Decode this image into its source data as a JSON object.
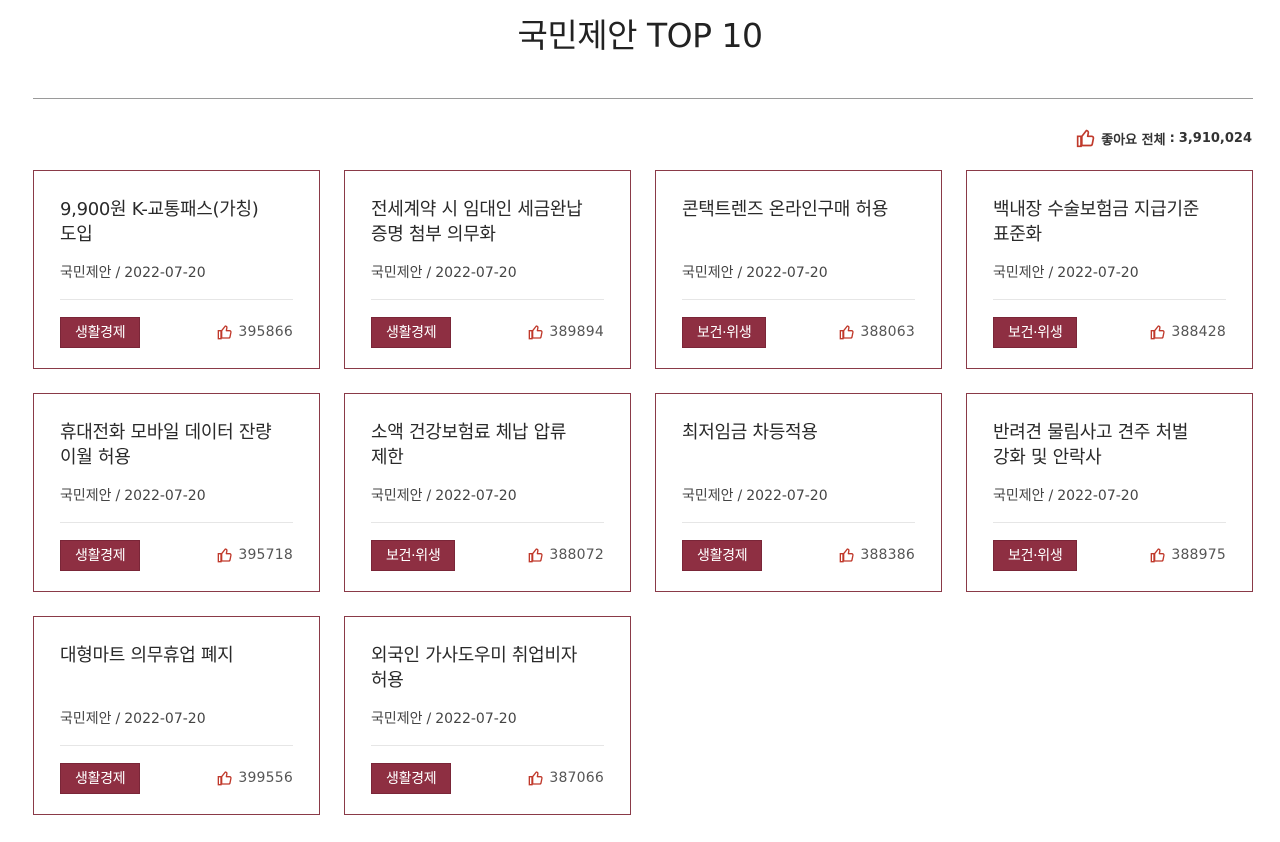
{
  "page_title": "국민제안 TOP 10",
  "summary": {
    "total_label": "좋아요 전체",
    "separator": ":",
    "total_value": "3,910,024"
  },
  "colors": {
    "accent": "#8e2f42",
    "card_border": "#8a3a48",
    "like_icon": "#c0392b"
  },
  "icons": {
    "like": "thumbs-up-icon"
  },
  "cards": [
    {
      "title": "9,900원 K-교통패스(가칭) 도입",
      "source": "국민제안",
      "date": "2022-07-20",
      "category": "생활경제",
      "likes": "395866"
    },
    {
      "title": "전세계약 시 임대인 세금완납 증명 첨부 의무화",
      "source": "국민제안",
      "date": "2022-07-20",
      "category": "생활경제",
      "likes": "389894"
    },
    {
      "title": "콘택트렌즈 온라인구매 허용",
      "source": "국민제안",
      "date": "2022-07-20",
      "category": "보건·위생",
      "likes": "388063"
    },
    {
      "title": "백내장 수술보험금 지급기준 표준화",
      "source": "국민제안",
      "date": "2022-07-20",
      "category": "보건·위생",
      "likes": "388428"
    },
    {
      "title": "휴대전화 모바일 데이터 잔량 이월 허용",
      "source": "국민제안",
      "date": "2022-07-20",
      "category": "생활경제",
      "likes": "395718"
    },
    {
      "title": "소액 건강보험료 체납 압류 제한",
      "source": "국민제안",
      "date": "2022-07-20",
      "category": "보건·위생",
      "likes": "388072"
    },
    {
      "title": "최저임금 차등적용",
      "source": "국민제안",
      "date": "2022-07-20",
      "category": "생활경제",
      "likes": "388386"
    },
    {
      "title": "반려견 물림사고 견주 처벌 강화 및 안락사",
      "source": "국민제안",
      "date": "2022-07-20",
      "category": "보건·위생",
      "likes": "388975"
    },
    {
      "title": "대형마트 의무휴업 폐지",
      "source": "국민제안",
      "date": "2022-07-20",
      "category": "생활경제",
      "likes": "399556"
    },
    {
      "title": "외국인 가사도우미 취업비자 허용",
      "source": "국민제안",
      "date": "2022-07-20",
      "category": "생활경제",
      "likes": "387066"
    }
  ]
}
